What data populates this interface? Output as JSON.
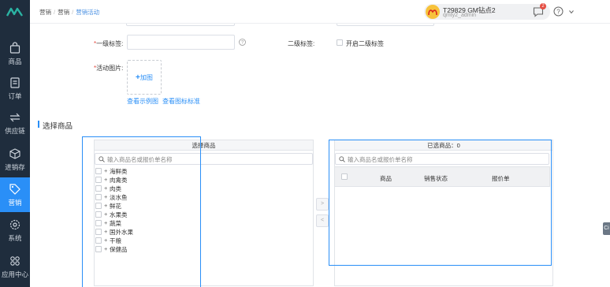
{
  "sidebar": {
    "items": [
      {
        "label": "商品",
        "icon": "bag-icon"
      },
      {
        "label": "订单",
        "icon": "order-icon"
      },
      {
        "label": "供应链",
        "icon": "exchange-icon"
      },
      {
        "label": "进销存",
        "icon": "cube-icon"
      },
      {
        "label": "营销",
        "icon": "tag-icon",
        "active": true
      },
      {
        "label": "系统",
        "icon": "gear-icon"
      },
      {
        "label": "应用中心",
        "icon": "apps-icon"
      }
    ]
  },
  "header": {
    "breadcrumb": [
      "营销",
      "营销",
      "营销活动"
    ],
    "user_name": "T29829 GM钻点2",
    "user_sub": "qmty2_admin",
    "badge_count": "2"
  },
  "form": {
    "primary_tag_label": "一级标签:",
    "secondary_tag_label": "二级标签:",
    "enable_secondary_label": "开启二级标签",
    "activity_image_label": "活动图片:",
    "upload_label": "加图",
    "view_example_link": "查看示例图",
    "view_icon_standard_link": "查看图标标准"
  },
  "section": {
    "title": "选择商品"
  },
  "left_panel": {
    "title": "选择商品",
    "search_placeholder": "输入商品名或报价单名称",
    "categories": [
      "海鲜类",
      "肉禽类",
      "肉类",
      "淡水鱼",
      "鲜花",
      "水果类",
      "蔬菜",
      "国外水果",
      "干粮",
      "保健品"
    ]
  },
  "right_panel": {
    "title": "已选商品：0",
    "search_placeholder": "输入商品名或报价单名称",
    "columns": [
      "商品",
      "销售状态",
      "报价单"
    ]
  },
  "colors": {
    "accent": "#2a8ff7",
    "sidebar_bg": "#1f2d3d",
    "badge": "#e54d42"
  }
}
